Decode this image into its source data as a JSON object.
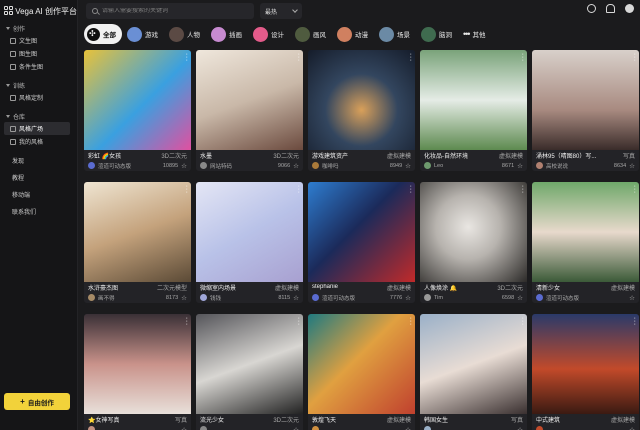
{
  "app": {
    "title": "Vega AI 创作平台"
  },
  "sidebar": {
    "sections": [
      {
        "head": "创作",
        "items": [
          {
            "label": "文生图",
            "active": false
          },
          {
            "label": "图生图",
            "active": false
          },
          {
            "label": "条件生图",
            "active": false
          }
        ]
      },
      {
        "head": "训练",
        "items": [
          {
            "label": "风格定制",
            "active": false
          }
        ]
      },
      {
        "head": "仓库",
        "items": [
          {
            "label": "风格广场",
            "active": true
          },
          {
            "label": "我的风格",
            "active": false
          }
        ]
      }
    ],
    "plain": [
      "发现",
      "教程",
      "移动端",
      "联系我们"
    ],
    "create_label": "自由创作"
  },
  "search": {
    "placeholder": "请输入需要搜索的关键词",
    "value": ""
  },
  "sort": {
    "label": "最热"
  },
  "categories": [
    {
      "label": "全部",
      "active": true,
      "color": "#111111"
    },
    {
      "label": "游戏",
      "color": "#6a8fd4"
    },
    {
      "label": "人物",
      "color": "#5b4a44"
    },
    {
      "label": "插画",
      "color": "#c78ad0"
    },
    {
      "label": "设计",
      "color": "#e35b8a"
    },
    {
      "label": "画风",
      "color": "#4f5b3f"
    },
    {
      "label": "动漫",
      "color": "#d08060"
    },
    {
      "label": "场景",
      "color": "#6b8aa5"
    },
    {
      "label": "脑洞",
      "color": "#3f6b4f"
    },
    {
      "label": "其他",
      "more": true
    }
  ],
  "cards": [
    {
      "name": "彩虹 🌈女孩",
      "tag": "3D二次元",
      "author": "渲道可动态版",
      "count": "10895",
      "bg": "linear-gradient(135deg,#e8c23a 0%,#3aa0e0 55%,#e050a0 100%)",
      "av": "#5a6bd0"
    },
    {
      "name": "水墨",
      "tag": "3D二次元",
      "author": "网站特码",
      "count": "9066",
      "bg": "linear-gradient(160deg,#efe7dc 0%,#c9b8a8 50%,#6b4a3e 100%)",
      "av": "#888888"
    },
    {
      "name": "游戏建筑资产",
      "tag": "虚拟建模",
      "author": "咖啡吗",
      "count": "8949",
      "bg": "radial-gradient(circle at 50% 60%,#d9a05a 0%,#33465f 45%,#151c2a 100%)",
      "av": "#aa7a3a"
    },
    {
      "name": "化妆品-自然环境",
      "tag": "虚拟建模",
      "author": "Leo",
      "count": "8671",
      "bg": "linear-gradient(180deg,#7aa37a 0%,#e5ece6 50%,#5d8a4f 100%)",
      "av": "#6e9a6e"
    },
    {
      "name": "涌林95（晴图80）写...",
      "tag": "写真",
      "author": "高校说说",
      "count": "8634",
      "bg": "linear-gradient(180deg,#d8d0ca 0%,#a88a80 60%,#3a2c2a 100%)",
      "av": "#b08070"
    },
    {
      "name": "水浒豪杰图",
      "tag": "二次元模型",
      "author": "画不得",
      "count": "8173",
      "bg": "linear-gradient(160deg,#efe5d2 0%,#c4a27c 50%,#5b4a36 100%)",
      "av": "#a58a66"
    },
    {
      "name": "微缩室内场景",
      "tag": "虚拟建模",
      "author": "钱钱",
      "count": "8115",
      "bg": "linear-gradient(150deg,#e4e6f5 0%,#b9c2e8 50%,#a8a0d0 100%)",
      "av": "#9fa6d8"
    },
    {
      "name": "stephanie",
      "tag": "虚拟建模",
      "author": "渲道可动态版",
      "count": "7776",
      "bg": "linear-gradient(135deg,#2e7dd0 0%,#1b2a5a 45%,#c02a2a 100%)",
      "av": "#5a6bd0"
    },
    {
      "name": "人像焕涂 🔔",
      "tag": "3D二次元",
      "author": "Tim",
      "count": "6598",
      "bg": "radial-gradient(circle at 45% 45%,#e9e6e2 0%,#b7b3ae 40%,#2c2a28 100%)",
      "av": "#999999"
    },
    {
      "name": "清新少女",
      "tag": "虚拟建模",
      "author": "渲道可动态版",
      "count": "",
      "bg": "linear-gradient(180deg,#6fa86a 0%,#e8d9cc 50%,#3b5a38 100%)",
      "av": "#5a6bd0"
    },
    {
      "name": "⭐女神写真",
      "tag": "写真",
      "author": "",
      "count": "",
      "bg": "linear-gradient(180deg,#3a3036 0%,#c9928a 50%,#e8e0da 100%)",
      "av": "#c09080"
    },
    {
      "name": "流光少女",
      "tag": "3D二次元",
      "author": "",
      "count": "",
      "bg": "linear-gradient(160deg,#55555a 0%,#d8d6d2 50%,#222 100%)",
      "av": "#888888"
    },
    {
      "name": "敦煌飞天",
      "tag": "虚拟建模",
      "author": "",
      "count": "",
      "bg": "linear-gradient(135deg,#1f7a80 0%,#e0a040 45%,#c0402e 100%)",
      "av": "#d09040"
    },
    {
      "name": "韩国女生",
      "tag": "写真",
      "author": "",
      "count": "",
      "bg": "linear-gradient(160deg,#9ab0c8 0%,#e8dcd4 50%,#3a3030 100%)",
      "av": "#9ab0c8"
    },
    {
      "name": "中式建筑",
      "tag": "虚拟建模",
      "author": "",
      "count": "",
      "bg": "linear-gradient(180deg,#2a3a6a 0%,#c24a2a 55%,#3a1a12 100%)",
      "av": "#c24a2a"
    }
  ]
}
